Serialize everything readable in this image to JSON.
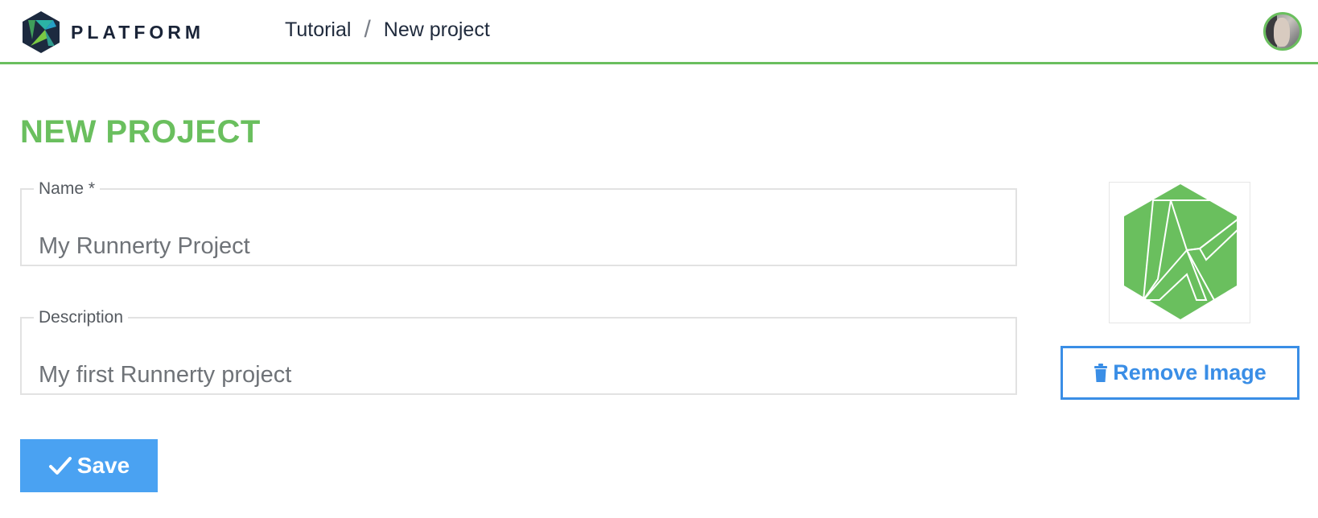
{
  "header": {
    "brand_name": "PLATFORM",
    "breadcrumb": [
      {
        "label": "Tutorial"
      },
      {
        "label": "New project"
      }
    ],
    "breadcrumb_separator": "/",
    "accent_color": "#6abf5e"
  },
  "page": {
    "title": "NEW PROJECT"
  },
  "form": {
    "name": {
      "label": "Name *",
      "value": "My Runnerty Project"
    },
    "description": {
      "label": "Description",
      "value": "My first Runnerty project"
    }
  },
  "image": {
    "remove_label": "Remove Image",
    "remove_icon": "trash-icon"
  },
  "actions": {
    "save_label": "Save",
    "save_icon": "check-icon",
    "button_color": "#4aa2f2"
  }
}
